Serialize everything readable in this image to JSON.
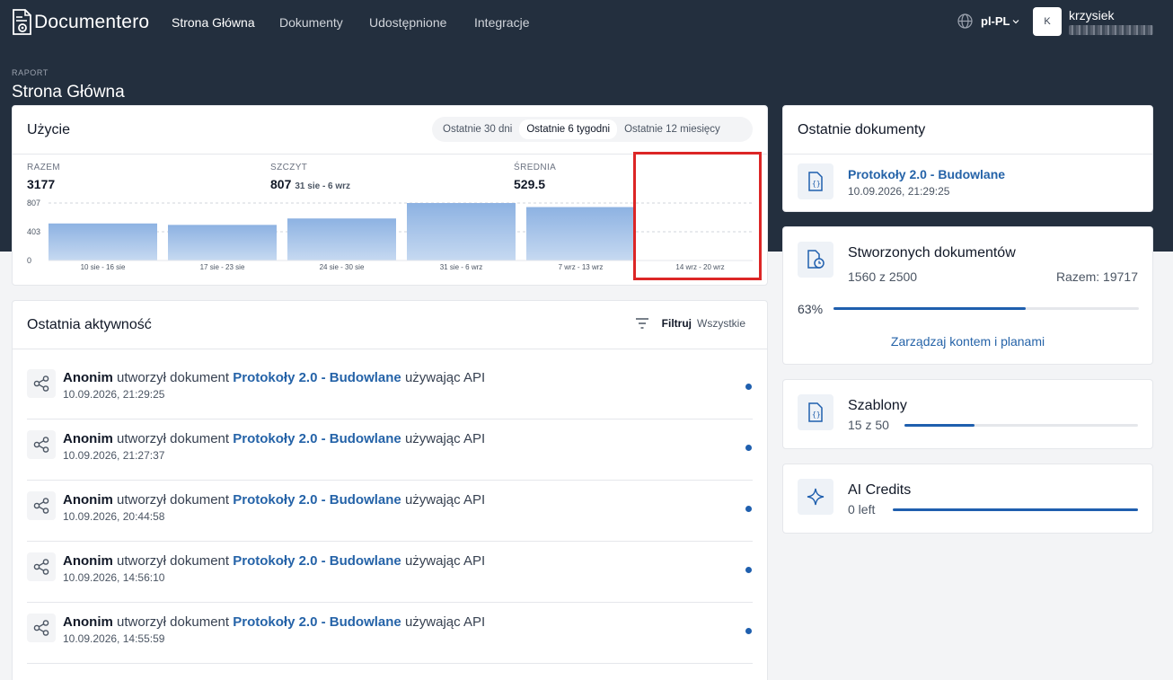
{
  "brand": {
    "name": "Documentero"
  },
  "nav": {
    "items": [
      "Strona Główna",
      "Dokumenty",
      "Udostępnione",
      "Integracje"
    ],
    "language": "pl-PL",
    "user_initial": "K",
    "user_name": "krzysiek"
  },
  "header": {
    "breadcrumb": "RAPORT",
    "title": "Strona Główna"
  },
  "usage": {
    "title": "Użycie",
    "ranges": [
      "Ostatnie 30 dni",
      "Ostatnie 6 tygodni",
      "Ostatnie 12 miesięcy"
    ],
    "selected_range": "Ostatnie 6 tygodni",
    "stats": {
      "total_label": "RAZEM",
      "total_value": "3177",
      "peak_label": "SZCZYT",
      "peak_value": "807",
      "peak_period": "31 sie - 6 wrz",
      "avg_label": "ŚREDNIA",
      "avg_value": "529.5"
    }
  },
  "chart_data": {
    "type": "bar",
    "categories": [
      "10 sie - 16 sie",
      "17 sie - 23 sie",
      "24 sie - 30 sie",
      "31 sie - 6 wrz",
      "7 wrz - 13 wrz",
      "14 wrz - 20 wrz"
    ],
    "values": [
      520,
      500,
      590,
      807,
      750,
      0
    ],
    "ylim": [
      0,
      807
    ],
    "yticks": [
      "807",
      "403",
      "0"
    ],
    "grid": true
  },
  "activity": {
    "title": "Ostatnia aktywność",
    "filter_label": "Filtruj",
    "filter_value": "Wszystkie",
    "items": [
      {
        "actor": "Anonim",
        "action": "utworzył dokument",
        "document": "Protokoły 2.0 - Budowlane",
        "suffix": "używając API",
        "time": "10.09.2026, 21:29:25"
      },
      {
        "actor": "Anonim",
        "action": "utworzył dokument",
        "document": "Protokoły 2.0 - Budowlane",
        "suffix": "używając API",
        "time": "10.09.2026, 21:27:37"
      },
      {
        "actor": "Anonim",
        "action": "utworzył dokument",
        "document": "Protokoły 2.0 - Budowlane",
        "suffix": "używając API",
        "time": "10.09.2026, 20:44:58"
      },
      {
        "actor": "Anonim",
        "action": "utworzył dokument",
        "document": "Protokoły 2.0 - Budowlane",
        "suffix": "używając API",
        "time": "10.09.2026, 14:56:10"
      },
      {
        "actor": "Anonim",
        "action": "utworzył dokument",
        "document": "Protokoły 2.0 - Budowlane",
        "suffix": "używając API",
        "time": "10.09.2026, 14:55:59"
      }
    ]
  },
  "recent_docs": {
    "title": "Ostatnie dokumenty",
    "items": [
      {
        "name": "Protokoły 2.0 - Budowlane",
        "time": "10.09.2026, 21:29:25"
      }
    ]
  },
  "created_docs": {
    "title": "Stworzonych dokumentów",
    "usage": "1560 z 2500",
    "total": "Razem: 19717",
    "percent_label": "63%",
    "percent": 0.63,
    "manage_link": "Zarządzaj kontem i planami"
  },
  "templates": {
    "title": "Szablony",
    "usage": "15 z 50",
    "fraction": 0.3
  },
  "ai_credits": {
    "title": "AI Credits",
    "usage": "0 left",
    "fraction": 1.0
  },
  "colors": {
    "header_bg": "#232f3e",
    "accent": "#1f5fae",
    "link": "#2563a8",
    "bar": "#9bbce6",
    "highlight": "#dc2626"
  }
}
